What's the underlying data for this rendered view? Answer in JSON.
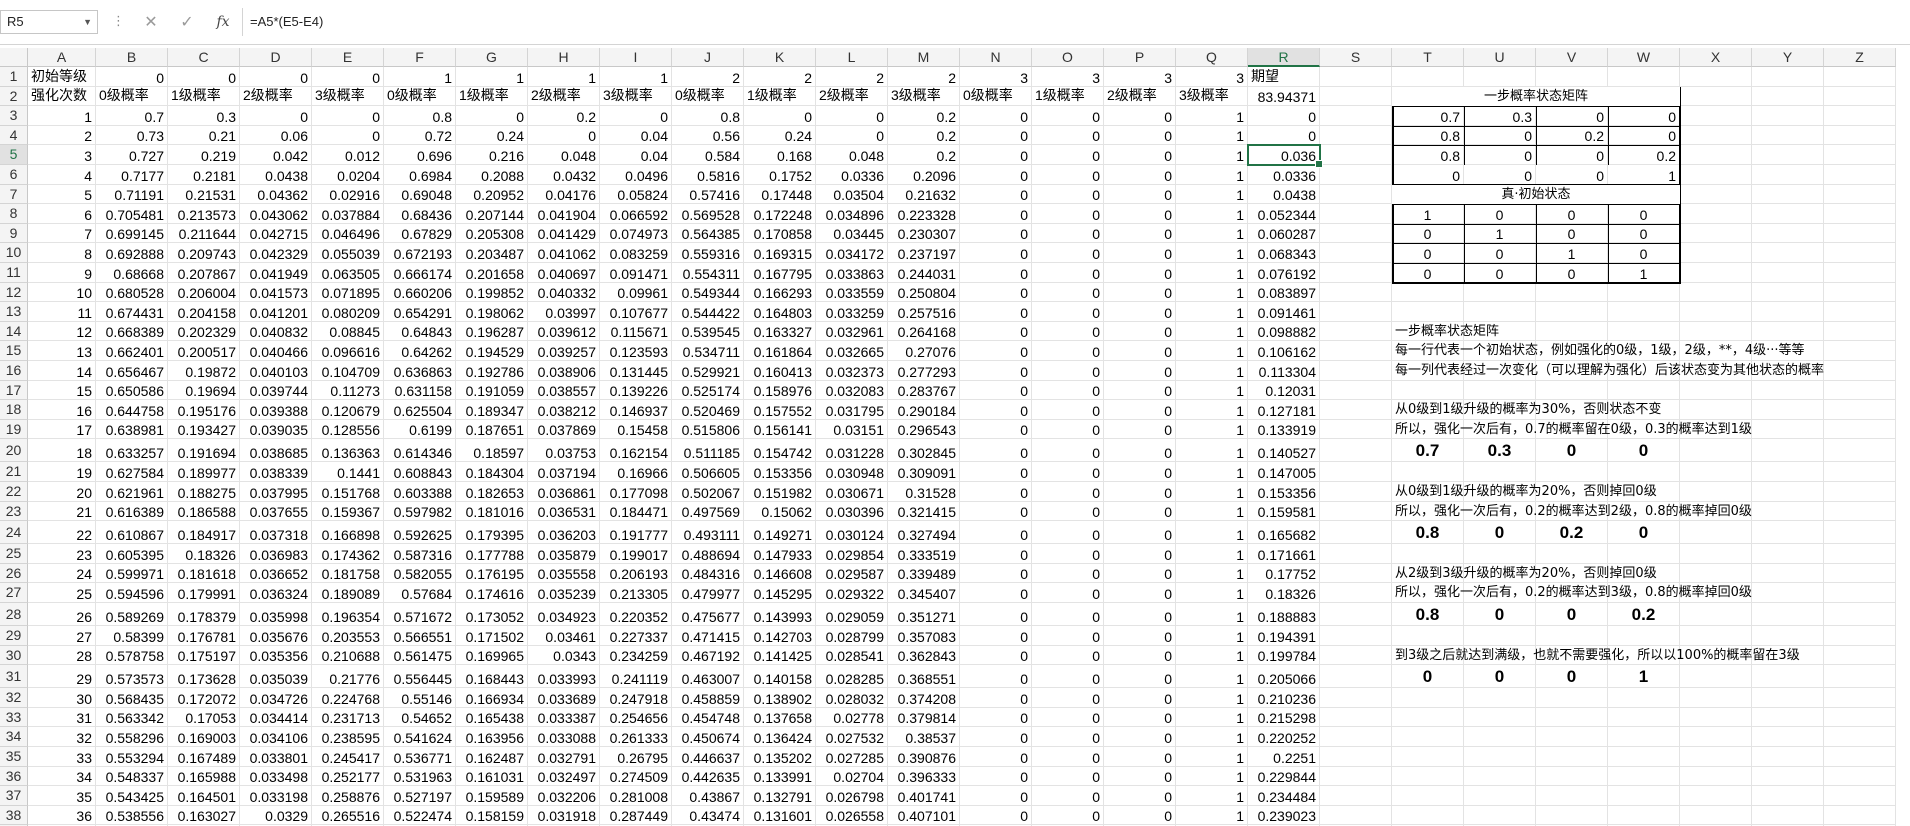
{
  "formula_bar": {
    "name_box": "R5",
    "formula": "=A5*(E5-E4)",
    "cancel_icon": "✕",
    "enter_icon": "✓",
    "fx_label": "fx"
  },
  "columns": [
    "A",
    "B",
    "C",
    "D",
    "E",
    "F",
    "G",
    "H",
    "I",
    "J",
    "K",
    "L",
    "M",
    "N",
    "O",
    "P",
    "Q",
    "R",
    "S",
    "T",
    "U",
    "V",
    "W",
    "X",
    "Y",
    "Z"
  ],
  "selected_column": "R",
  "selected_row": 5,
  "rows": [
    {
      "n": 1,
      "cells": {
        "A": "初始等级",
        "B": "0",
        "C": "0",
        "D": "0",
        "E": "0",
        "F": "1",
        "G": "1",
        "H": "1",
        "I": "1",
        "J": "2",
        "K": "2",
        "L": "2",
        "M": "2",
        "N": "3",
        "O": "3",
        "P": "3",
        "Q": "3",
        "R": "期望"
      }
    },
    {
      "n": 2,
      "cells": {
        "A": "强化次数",
        "B": "0级概率",
        "C": "1级概率",
        "D": "2级概率",
        "E": "3级概率",
        "F": "0级概率",
        "G": "1级概率",
        "H": "2级概率",
        "I": "3级概率",
        "J": "0级概率",
        "K": "1级概率",
        "L": "2级概率",
        "M": "3级概率",
        "N": "0级概率",
        "O": "1级概率",
        "P": "2级概率",
        "Q": "3级概率",
        "R": "83.94371"
      }
    },
    {
      "n": 3,
      "cells": {
        "A": "1",
        "B": "0.7",
        "C": "0.3",
        "D": "0",
        "E": "0",
        "F": "0.8",
        "G": "0",
        "H": "0.2",
        "I": "0",
        "J": "0.8",
        "K": "0",
        "L": "0",
        "M": "0.2",
        "N": "0",
        "O": "0",
        "P": "0",
        "Q": "1",
        "R": "0",
        "T": "0.7",
        "U": "0.3",
        "V": "0",
        "W": "0"
      }
    },
    {
      "n": 4,
      "cells": {
        "A": "2",
        "B": "0.73",
        "C": "0.21",
        "D": "0.06",
        "E": "0",
        "F": "0.72",
        "G": "0.24",
        "H": "0",
        "I": "0.04",
        "J": "0.56",
        "K": "0.24",
        "L": "0",
        "M": "0.2",
        "N": "0",
        "O": "0",
        "P": "0",
        "Q": "1",
        "R": "0",
        "T": "0.8",
        "U": "0",
        "V": "0.2",
        "W": "0"
      }
    },
    {
      "n": 5,
      "cells": {
        "A": "3",
        "B": "0.727",
        "C": "0.219",
        "D": "0.042",
        "E": "0.012",
        "F": "0.696",
        "G": "0.216",
        "H": "0.048",
        "I": "0.04",
        "J": "0.584",
        "K": "0.168",
        "L": "0.048",
        "M": "0.2",
        "N": "0",
        "O": "0",
        "P": "0",
        "Q": "1",
        "R": "0.036",
        "T": "0.8",
        "U": "0",
        "V": "0",
        "W": "0.2"
      }
    },
    {
      "n": 6,
      "cells": {
        "A": "4",
        "B": "0.7177",
        "C": "0.2181",
        "D": "0.0438",
        "E": "0.0204",
        "F": "0.6984",
        "G": "0.2088",
        "H": "0.0432",
        "I": "0.0496",
        "J": "0.5816",
        "K": "0.1752",
        "L": "0.0336",
        "M": "0.2096",
        "N": "0",
        "O": "0",
        "P": "0",
        "Q": "1",
        "R": "0.0336",
        "T": "0",
        "U": "0",
        "V": "0",
        "W": "1"
      }
    },
    {
      "n": 7,
      "cells": {
        "A": "5",
        "B": "0.71191",
        "C": "0.21531",
        "D": "0.04362",
        "E": "0.02916",
        "F": "0.69048",
        "G": "0.20952",
        "H": "0.04176",
        "I": "0.05824",
        "J": "0.57416",
        "K": "0.17448",
        "L": "0.03504",
        "M": "0.21632",
        "N": "0",
        "O": "0",
        "P": "0",
        "Q": "1",
        "R": "0.0438"
      }
    },
    {
      "n": 8,
      "cells": {
        "A": "6",
        "B": "0.705481",
        "C": "0.213573",
        "D": "0.043062",
        "E": "0.037884",
        "F": "0.68436",
        "G": "0.207144",
        "H": "0.041904",
        "I": "0.066592",
        "J": "0.569528",
        "K": "0.172248",
        "L": "0.034896",
        "M": "0.223328",
        "N": "0",
        "O": "0",
        "P": "0",
        "Q": "1",
        "R": "0.052344",
        "T": "1",
        "U": "0",
        "V": "0",
        "W": "0"
      }
    },
    {
      "n": 9,
      "cells": {
        "A": "7",
        "B": "0.699145",
        "C": "0.211644",
        "D": "0.042715",
        "E": "0.046496",
        "F": "0.67829",
        "G": "0.205308",
        "H": "0.041429",
        "I": "0.074973",
        "J": "0.564385",
        "K": "0.170858",
        "L": "0.03445",
        "M": "0.230307",
        "N": "0",
        "O": "0",
        "P": "0",
        "Q": "1",
        "R": "0.060287",
        "T": "0",
        "U": "1",
        "V": "0",
        "W": "0"
      }
    },
    {
      "n": 10,
      "cells": {
        "A": "8",
        "B": "0.692888",
        "C": "0.209743",
        "D": "0.042329",
        "E": "0.055039",
        "F": "0.672193",
        "G": "0.203487",
        "H": "0.041062",
        "I": "0.083259",
        "J": "0.559316",
        "K": "0.169315",
        "L": "0.034172",
        "M": "0.237197",
        "N": "0",
        "O": "0",
        "P": "0",
        "Q": "1",
        "R": "0.068343",
        "T": "0",
        "U": "0",
        "V": "1",
        "W": "0"
      }
    },
    {
      "n": 11,
      "cells": {
        "A": "9",
        "B": "0.68668",
        "C": "0.207867",
        "D": "0.041949",
        "E": "0.063505",
        "F": "0.666174",
        "G": "0.201658",
        "H": "0.040697",
        "I": "0.091471",
        "J": "0.554311",
        "K": "0.167795",
        "L": "0.033863",
        "M": "0.244031",
        "N": "0",
        "O": "0",
        "P": "0",
        "Q": "1",
        "R": "0.076192",
        "T": "0",
        "U": "0",
        "V": "0",
        "W": "1"
      }
    },
    {
      "n": 12,
      "cells": {
        "A": "10",
        "B": "0.680528",
        "C": "0.206004",
        "D": "0.041573",
        "E": "0.071895",
        "F": "0.660206",
        "G": "0.199852",
        "H": "0.040332",
        "I": "0.09961",
        "J": "0.549344",
        "K": "0.166293",
        "L": "0.033559",
        "M": "0.250804",
        "N": "0",
        "O": "0",
        "P": "0",
        "Q": "1",
        "R": "0.083897"
      }
    },
    {
      "n": 13,
      "cells": {
        "A": "11",
        "B": "0.674431",
        "C": "0.204158",
        "D": "0.041201",
        "E": "0.080209",
        "F": "0.654291",
        "G": "0.198062",
        "H": "0.03997",
        "I": "0.107677",
        "J": "0.544422",
        "K": "0.164803",
        "L": "0.033259",
        "M": "0.257516",
        "N": "0",
        "O": "0",
        "P": "0",
        "Q": "1",
        "R": "0.091461"
      }
    },
    {
      "n": 14,
      "cells": {
        "A": "12",
        "B": "0.668389",
        "C": "0.202329",
        "D": "0.040832",
        "E": "0.08845",
        "F": "0.64843",
        "G": "0.196287",
        "H": "0.039612",
        "I": "0.115671",
        "J": "0.539545",
        "K": "0.163327",
        "L": "0.032961",
        "M": "0.264168",
        "N": "0",
        "O": "0",
        "P": "0",
        "Q": "1",
        "R": "0.098882"
      }
    },
    {
      "n": 15,
      "cells": {
        "A": "13",
        "B": "0.662401",
        "C": "0.200517",
        "D": "0.040466",
        "E": "0.096616",
        "F": "0.64262",
        "G": "0.194529",
        "H": "0.039257",
        "I": "0.123593",
        "J": "0.534711",
        "K": "0.161864",
        "L": "0.032665",
        "M": "0.27076",
        "N": "0",
        "O": "0",
        "P": "0",
        "Q": "1",
        "R": "0.106162"
      }
    },
    {
      "n": 16,
      "cells": {
        "A": "14",
        "B": "0.656467",
        "C": "0.19872",
        "D": "0.040103",
        "E": "0.104709",
        "F": "0.636863",
        "G": "0.192786",
        "H": "0.038906",
        "I": "0.131445",
        "J": "0.529921",
        "K": "0.160413",
        "L": "0.032373",
        "M": "0.277293",
        "N": "0",
        "O": "0",
        "P": "0",
        "Q": "1",
        "R": "0.113304"
      }
    },
    {
      "n": 17,
      "cells": {
        "A": "15",
        "B": "0.650586",
        "C": "0.19694",
        "D": "0.039744",
        "E": "0.11273",
        "F": "0.631158",
        "G": "0.191059",
        "H": "0.038557",
        "I": "0.139226",
        "J": "0.525174",
        "K": "0.158976",
        "L": "0.032083",
        "M": "0.283767",
        "N": "0",
        "O": "0",
        "P": "0",
        "Q": "1",
        "R": "0.12031"
      }
    },
    {
      "n": 18,
      "cells": {
        "A": "16",
        "B": "0.644758",
        "C": "0.195176",
        "D": "0.039388",
        "E": "0.120679",
        "F": "0.625504",
        "G": "0.189347",
        "H": "0.038212",
        "I": "0.146937",
        "J": "0.520469",
        "K": "0.157552",
        "L": "0.031795",
        "M": "0.290184",
        "N": "0",
        "O": "0",
        "P": "0",
        "Q": "1",
        "R": "0.127181"
      }
    },
    {
      "n": 19,
      "cells": {
        "A": "17",
        "B": "0.638981",
        "C": "0.193427",
        "D": "0.039035",
        "E": "0.128556",
        "F": "0.6199",
        "G": "0.187651",
        "H": "0.037869",
        "I": "0.15458",
        "J": "0.515806",
        "K": "0.156141",
        "L": "0.03151",
        "M": "0.296543",
        "N": "0",
        "O": "0",
        "P": "0",
        "Q": "1",
        "R": "0.133919"
      }
    },
    {
      "n": 20,
      "cells": {
        "A": "18",
        "B": "0.633257",
        "C": "0.191694",
        "D": "0.038685",
        "E": "0.136363",
        "F": "0.614346",
        "G": "0.18597",
        "H": "0.03753",
        "I": "0.162154",
        "J": "0.511185",
        "K": "0.154742",
        "L": "0.031228",
        "M": "0.302845",
        "N": "0",
        "O": "0",
        "P": "0",
        "Q": "1",
        "R": "0.140527",
        "T": "0.7",
        "U": "0.3",
        "V": "0",
        "W": "0"
      }
    },
    {
      "n": 21,
      "cells": {
        "A": "19",
        "B": "0.627584",
        "C": "0.189977",
        "D": "0.038339",
        "E": "0.1441",
        "F": "0.608843",
        "G": "0.184304",
        "H": "0.037194",
        "I": "0.16966",
        "J": "0.506605",
        "K": "0.153356",
        "L": "0.030948",
        "M": "0.309091",
        "N": "0",
        "O": "0",
        "P": "0",
        "Q": "1",
        "R": "0.147005"
      }
    },
    {
      "n": 22,
      "cells": {
        "A": "20",
        "B": "0.621961",
        "C": "0.188275",
        "D": "0.037995",
        "E": "0.151768",
        "F": "0.603388",
        "G": "0.182653",
        "H": "0.036861",
        "I": "0.177098",
        "J": "0.502067",
        "K": "0.151982",
        "L": "0.030671",
        "M": "0.31528",
        "N": "0",
        "O": "0",
        "P": "0",
        "Q": "1",
        "R": "0.153356"
      }
    },
    {
      "n": 23,
      "cells": {
        "A": "21",
        "B": "0.616389",
        "C": "0.186588",
        "D": "0.037655",
        "E": "0.159367",
        "F": "0.597982",
        "G": "0.181016",
        "H": "0.036531",
        "I": "0.184471",
        "J": "0.497569",
        "K": "0.15062",
        "L": "0.030396",
        "M": "0.321415",
        "N": "0",
        "O": "0",
        "P": "0",
        "Q": "1",
        "R": "0.159581"
      }
    },
    {
      "n": 24,
      "cells": {
        "A": "22",
        "B": "0.610867",
        "C": "0.184917",
        "D": "0.037318",
        "E": "0.166898",
        "F": "0.592625",
        "G": "0.179395",
        "H": "0.036203",
        "I": "0.191777",
        "J": "0.493111",
        "K": "0.149271",
        "L": "0.030124",
        "M": "0.327494",
        "N": "0",
        "O": "0",
        "P": "0",
        "Q": "1",
        "R": "0.165682",
        "T": "0.8",
        "U": "0",
        "V": "0.2",
        "W": "0"
      }
    },
    {
      "n": 25,
      "cells": {
        "A": "23",
        "B": "0.605395",
        "C": "0.18326",
        "D": "0.036983",
        "E": "0.174362",
        "F": "0.587316",
        "G": "0.177788",
        "H": "0.035879",
        "I": "0.199017",
        "J": "0.488694",
        "K": "0.147933",
        "L": "0.029854",
        "M": "0.333519",
        "N": "0",
        "O": "0",
        "P": "0",
        "Q": "1",
        "R": "0.171661"
      }
    },
    {
      "n": 26,
      "cells": {
        "A": "24",
        "B": "0.599971",
        "C": "0.181618",
        "D": "0.036652",
        "E": "0.181758",
        "F": "0.582055",
        "G": "0.176195",
        "H": "0.035558",
        "I": "0.206193",
        "J": "0.484316",
        "K": "0.146608",
        "L": "0.029587",
        "M": "0.339489",
        "N": "0",
        "O": "0",
        "P": "0",
        "Q": "1",
        "R": "0.17752"
      }
    },
    {
      "n": 27,
      "cells": {
        "A": "25",
        "B": "0.594596",
        "C": "0.179991",
        "D": "0.036324",
        "E": "0.189089",
        "F": "0.57684",
        "G": "0.174616",
        "H": "0.035239",
        "I": "0.213305",
        "J": "0.479977",
        "K": "0.145295",
        "L": "0.029322",
        "M": "0.345407",
        "N": "0",
        "O": "0",
        "P": "0",
        "Q": "1",
        "R": "0.18326"
      }
    },
    {
      "n": 28,
      "cells": {
        "A": "26",
        "B": "0.589269",
        "C": "0.178379",
        "D": "0.035998",
        "E": "0.196354",
        "F": "0.571672",
        "G": "0.173052",
        "H": "0.034923",
        "I": "0.220352",
        "J": "0.475677",
        "K": "0.143993",
        "L": "0.029059",
        "M": "0.351271",
        "N": "0",
        "O": "0",
        "P": "0",
        "Q": "1",
        "R": "0.188883",
        "T": "0.8",
        "U": "0",
        "V": "0",
        "W": "0.2"
      }
    },
    {
      "n": 29,
      "cells": {
        "A": "27",
        "B": "0.58399",
        "C": "0.176781",
        "D": "0.035676",
        "E": "0.203553",
        "F": "0.566551",
        "G": "0.171502",
        "H": "0.03461",
        "I": "0.227337",
        "J": "0.471415",
        "K": "0.142703",
        "L": "0.028799",
        "M": "0.357083",
        "N": "0",
        "O": "0",
        "P": "0",
        "Q": "1",
        "R": "0.194391"
      }
    },
    {
      "n": 30,
      "cells": {
        "A": "28",
        "B": "0.578758",
        "C": "0.175197",
        "D": "0.035356",
        "E": "0.210688",
        "F": "0.561475",
        "G": "0.169965",
        "H": "0.0343",
        "I": "0.234259",
        "J": "0.467192",
        "K": "0.141425",
        "L": "0.028541",
        "M": "0.362843",
        "N": "0",
        "O": "0",
        "P": "0",
        "Q": "1",
        "R": "0.199784"
      }
    },
    {
      "n": 31,
      "cells": {
        "A": "29",
        "B": "0.573573",
        "C": "0.173628",
        "D": "0.035039",
        "E": "0.21776",
        "F": "0.556445",
        "G": "0.168443",
        "H": "0.033993",
        "I": "0.241119",
        "J": "0.463007",
        "K": "0.140158",
        "L": "0.028285",
        "M": "0.368551",
        "N": "0",
        "O": "0",
        "P": "0",
        "Q": "1",
        "R": "0.205066",
        "T": "0",
        "U": "0",
        "V": "0",
        "W": "1"
      }
    },
    {
      "n": 32,
      "cells": {
        "A": "30",
        "B": "0.568435",
        "C": "0.172072",
        "D": "0.034726",
        "E": "0.224768",
        "F": "0.55146",
        "G": "0.166934",
        "H": "0.033689",
        "I": "0.247918",
        "J": "0.458859",
        "K": "0.138902",
        "L": "0.028032",
        "M": "0.374208",
        "N": "0",
        "O": "0",
        "P": "0",
        "Q": "1",
        "R": "0.210236"
      }
    },
    {
      "n": 33,
      "cells": {
        "A": "31",
        "B": "0.563342",
        "C": "0.17053",
        "D": "0.034414",
        "E": "0.231713",
        "F": "0.54652",
        "G": "0.165438",
        "H": "0.033387",
        "I": "0.254656",
        "J": "0.454748",
        "K": "0.137658",
        "L": "0.02778",
        "M": "0.379814",
        "N": "0",
        "O": "0",
        "P": "0",
        "Q": "1",
        "R": "0.215298"
      }
    },
    {
      "n": 34,
      "cells": {
        "A": "32",
        "B": "0.558296",
        "C": "0.169003",
        "D": "0.034106",
        "E": "0.238595",
        "F": "0.541624",
        "G": "0.163956",
        "H": "0.033088",
        "I": "0.261333",
        "J": "0.450674",
        "K": "0.136424",
        "L": "0.027532",
        "M": "0.38537",
        "N": "0",
        "O": "0",
        "P": "0",
        "Q": "1",
        "R": "0.220252"
      }
    },
    {
      "n": 35,
      "cells": {
        "A": "33",
        "B": "0.553294",
        "C": "0.167489",
        "D": "0.033801",
        "E": "0.245417",
        "F": "0.536771",
        "G": "0.162487",
        "H": "0.032791",
        "I": "0.26795",
        "J": "0.446637",
        "K": "0.135202",
        "L": "0.027285",
        "M": "0.390876",
        "N": "0",
        "O": "0",
        "P": "0",
        "Q": "1",
        "R": "0.2251"
      }
    },
    {
      "n": 36,
      "cells": {
        "A": "34",
        "B": "0.548337",
        "C": "0.165988",
        "D": "0.033498",
        "E": "0.252177",
        "F": "0.531963",
        "G": "0.161031",
        "H": "0.032497",
        "I": "0.274509",
        "J": "0.442635",
        "K": "0.133991",
        "L": "0.02704",
        "M": "0.396333",
        "N": "0",
        "O": "0",
        "P": "0",
        "Q": "1",
        "R": "0.229844"
      }
    },
    {
      "n": 37,
      "cells": {
        "A": "35",
        "B": "0.543425",
        "C": "0.164501",
        "D": "0.033198",
        "E": "0.258876",
        "F": "0.527197",
        "G": "0.159589",
        "H": "0.032206",
        "I": "0.281008",
        "J": "0.43867",
        "K": "0.132791",
        "L": "0.026798",
        "M": "0.401741",
        "N": "0",
        "O": "0",
        "P": "0",
        "Q": "1",
        "R": "0.234484"
      }
    },
    {
      "n": 38,
      "cells": {
        "A": "36",
        "B": "0.538556",
        "C": "0.163027",
        "D": "0.0329",
        "E": "0.265516",
        "F": "0.522474",
        "G": "0.158159",
        "H": "0.031918",
        "I": "0.287449",
        "J": "0.43474",
        "K": "0.131601",
        "L": "0.026558",
        "M": "0.407101",
        "N": "0",
        "O": "0",
        "P": "0",
        "Q": "1",
        "R": "0.239023"
      }
    },
    {
      "n": 39,
      "cells": {}
    }
  ],
  "box1_title": "一步概率状态矩阵",
  "box2_title": "真·初始状态",
  "notes": {
    "n16": "一步概率状态矩阵",
    "n17": "每一行代表一个初始状态，例如强化的0级，1级，2级，**，4级···等等",
    "n18": "每一列代表经过一次变化（可以理解为强化）后该状态变为其他状态的概率",
    "n20": "从0级到1级升级的概率为30%，否则状态不变",
    "n21": "所以，强化一次后有，0.7的概率留在0级，0.3的概率达到1级",
    "n24": "从0级到1级升级的概率为20%，否则掉回0级",
    "n25": "所以，强化一次后有，0.2的概率达到2级，0.8的概率掉回0级",
    "n28": "从2级到3级升级的概率为20%，否则掉回0级",
    "n29": "所以，强化一次后有，0.2的概率达到3级，0.8的概率掉回0级",
    "n32": "到3级之后就达到满级，也就不需要强化，所以以100%的概率留在3级"
  }
}
